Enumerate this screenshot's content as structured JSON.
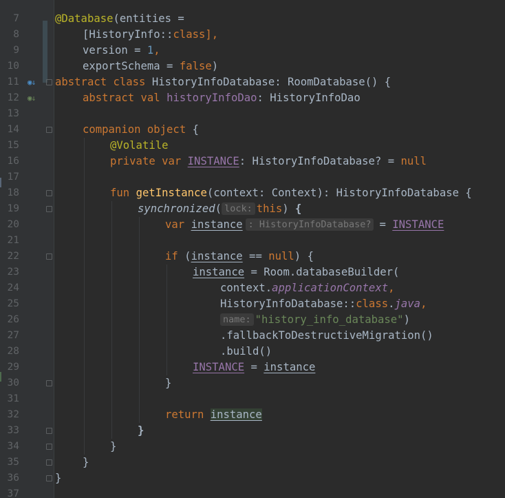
{
  "editor": {
    "language": "kotlin",
    "colors": {
      "background": "#2B2B2B",
      "gutter": "#313335",
      "keyword": "#CC7832",
      "annotation": "#BBB529",
      "number": "#6897BB",
      "string": "#6A8759",
      "function": "#FFC66D",
      "property": "#9876AA",
      "default_text": "#A9B7C6",
      "line_number": "#606366"
    },
    "gutter_icons": {
      "line_12": "implemented-icon",
      "line_13": "implementing-icon"
    },
    "line_numbers": [
      "7",
      "8",
      "9",
      "10",
      "11",
      "12",
      "13",
      "14",
      "15",
      "16",
      "17",
      "18",
      "19",
      "20",
      "21",
      "22",
      "23",
      "24",
      "25",
      "26",
      "27",
      "28",
      "29",
      "30",
      "31",
      "32",
      "33",
      "34",
      "35",
      "36",
      "37"
    ],
    "tokens": {
      "l8_ann": "@Database",
      "l8_rest": "(entities =",
      "l9_a": "[HistoryInfo::",
      "l9_kw": "class",
      "l9_b": "],",
      "l10_a": "version = ",
      "l10_num": "1",
      "l10_b": ",",
      "l11_a": "exportSchema = ",
      "l11_kw": "false",
      "l11_b": ")",
      "l12_kw": "abstract class ",
      "l12_rest": "HistoryInfoDatabase: RoomDatabase() {",
      "l13_kw": "abstract val ",
      "l13_prop": "historyInfoDao",
      "l13_rest": ": HistoryInfoDao",
      "l15_kw": "companion object ",
      "l15_rest": "{",
      "l16_ann": "@Volatile",
      "l17_kw": "private var ",
      "l17_prop": "INSTANCE",
      "l17_rest": ": HistoryInfoDatabase? = ",
      "l17_null": "null",
      "l19_kw": "fun ",
      "l19_fn": "getInstance",
      "l19_rest": "(context: Context): HistoryInfoDatabase {",
      "l20_fn": "synchronized",
      "l20_paren": "(",
      "l20_hint": "lock:",
      "l20_this": "this",
      "l20_rest": ") ",
      "l20_brace": "{",
      "l21_kw": "var ",
      "l21_var": "instance",
      "l21_hint": ": HistoryInfoDatabase?",
      "l21_eq": "= ",
      "l21_prop": "INSTANCE",
      "l23_kw": "if ",
      "l23_p": "(",
      "l23_var": "instance",
      "l23_op": " == ",
      "l23_null": "null",
      "l23_rest": ") {",
      "l24_var": "instance",
      "l24_rest": " = Room.databaseBuilder(",
      "l25_a": "context.",
      "l25_prop": "applicationContext",
      "l25_b": ",",
      "l26_a": "HistoryInfoDatabase::",
      "l26_kw": "class",
      "l26_dot": ".",
      "l26_prop": "java",
      "l26_b": ",",
      "l27_hint": "name:",
      "l27_str": "\"history_info_database\"",
      "l27_b": ")",
      "l28": ".fallbackToDestructiveMigration()",
      "l29": ".build()",
      "l30_prop": "INSTANCE",
      "l30_eq": " = ",
      "l30_var": "instance",
      "l31": "}",
      "l33_kw": "return ",
      "l33_var": "instance",
      "l34": "}",
      "l35": "}",
      "l36": "}",
      "l37": "}"
    }
  }
}
